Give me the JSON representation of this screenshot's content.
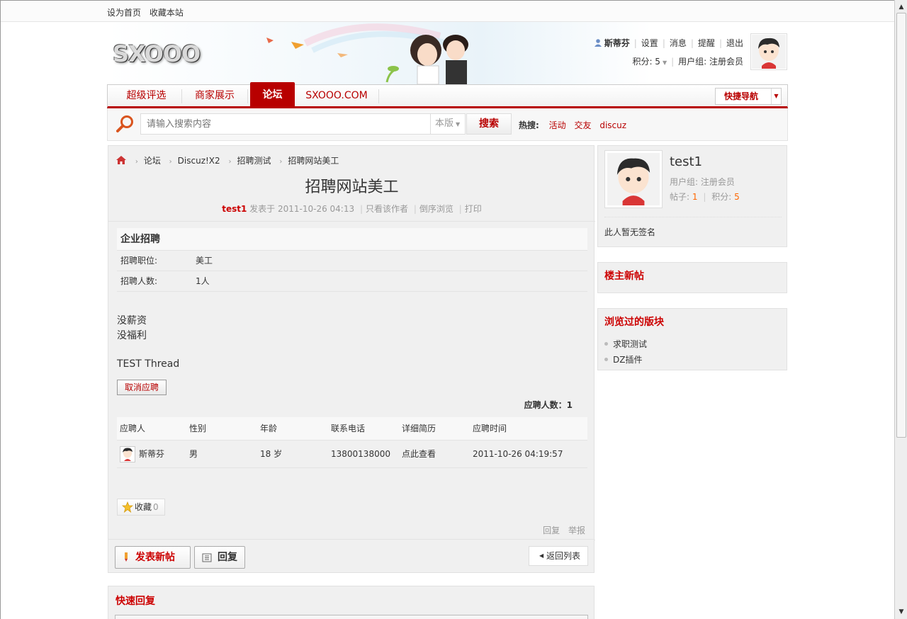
{
  "topbar": {
    "links": [
      "设为首页",
      "收藏本站"
    ]
  },
  "header": {
    "logo": "SXOOO",
    "user": {
      "name": "斯蒂芬",
      "links": [
        "设置",
        "消息",
        "提醒",
        "退出"
      ],
      "points_label": "积分: 5",
      "group_label": "用户组: 注册会员"
    }
  },
  "nav": {
    "items": [
      "超级评选",
      "商家展示",
      "论坛",
      "SXOOO.COM"
    ],
    "active": "论坛",
    "quicknav": "快捷导航"
  },
  "search": {
    "placeholder": "请输入搜索内容",
    "scope": "本版",
    "button": "搜索",
    "hot_label": "热搜:",
    "hot_terms": [
      "活动",
      "交友",
      "discuz"
    ]
  },
  "breadcrumb": [
    "论坛",
    "Discuz!X2",
    "招聘测试",
    "招聘网站美工"
  ],
  "thread": {
    "title": "招聘网站美工",
    "author": "test1",
    "posted": "发表于 2011-10-26 04:13",
    "actions": [
      "只看该作者",
      "倒序浏览",
      "打印"
    ]
  },
  "job": {
    "heading": "企业招聘",
    "rows": [
      {
        "key": "招聘职位:",
        "value": "美工"
      },
      {
        "key": "招聘人数:",
        "value": "1人"
      }
    ]
  },
  "content": {
    "lines": [
      "没薪资",
      "没福利",
      "TEST Thread"
    ]
  },
  "cancel_button": "取消应聘",
  "applicants": {
    "count_label": "应聘人数：1",
    "headers": [
      "应聘人",
      "性别",
      "年龄",
      "联系电话",
      "详细简历",
      "应聘时间"
    ],
    "rows": [
      {
        "name": "斯蒂芬",
        "gender": "男",
        "age": "18 岁",
        "phone": "13800138000",
        "resume": "点此查看",
        "time": "2011-10-26 04:19:57"
      }
    ]
  },
  "favorite": {
    "label": "收藏",
    "count": "0"
  },
  "post_actions": [
    "回复",
    "举报"
  ],
  "bottom": {
    "new_post": "发表新帖",
    "reply": "回复",
    "back": "返回列表"
  },
  "quick_reply": {
    "title": "快速回复"
  },
  "sidebar": {
    "profile": {
      "name": "test1",
      "group": "用户组: 注册会员",
      "posts_label": "帖子:",
      "posts": "1",
      "points_label": "积分:",
      "points": "5",
      "signature": "此人暂无签名"
    },
    "owner_posts_title": "楼主新帖",
    "browsed_title": "浏览过的版块",
    "browsed": [
      "求职测试",
      "DZ插件"
    ]
  },
  "colors": {
    "accent": "#b80000",
    "link": "#cc0000",
    "highlight": "#ff6600"
  }
}
